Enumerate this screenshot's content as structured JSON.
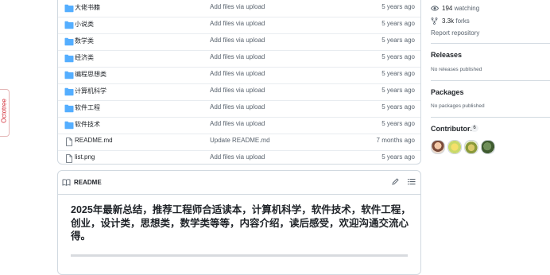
{
  "side_tab": {
    "label": "Octotree"
  },
  "files": [
    {
      "name": "大佬书籍",
      "type": "folder",
      "message": "Add files via upload",
      "age": "5 years ago"
    },
    {
      "name": "小说类",
      "type": "folder",
      "message": "Add files via upload",
      "age": "5 years ago"
    },
    {
      "name": "数学类",
      "type": "folder",
      "message": "Add files via upload",
      "age": "5 years ago"
    },
    {
      "name": "经济类",
      "type": "folder",
      "message": "Add files via upload",
      "age": "5 years ago"
    },
    {
      "name": "编程思想类",
      "type": "folder",
      "message": "Add files via upload",
      "age": "5 years ago"
    },
    {
      "name": "计算机科学",
      "type": "folder",
      "message": "Add files via upload",
      "age": "5 years ago"
    },
    {
      "name": "软件工程",
      "type": "folder",
      "message": "Add files via upload",
      "age": "5 years ago"
    },
    {
      "name": "软件技术",
      "type": "folder",
      "message": "Add files via upload",
      "age": "5 years ago"
    },
    {
      "name": "README.md",
      "type": "file",
      "message": "Update README.md",
      "age": "7 months ago"
    },
    {
      "name": "list.png",
      "type": "file",
      "message": "Add files via upload",
      "age": "5 years ago"
    }
  ],
  "readme": {
    "tab_label": "README",
    "heading": "2025年最新总结，推荐工程师合适读本，计算机科学，软件技术，软件工程，创业，设计类，思想类，数学类等等，内容介绍，读后感受，欢迎沟通交流心得。"
  },
  "sidebar": {
    "watching_count": "194",
    "watching_label": "watching",
    "forks_count": "3.3k",
    "forks_label": "forks",
    "report": "Report repository",
    "releases_title": "Releases",
    "releases_empty": "No releases published",
    "packages_title": "Packages",
    "packages_empty": "No packages published",
    "contributors_title": "Contributors",
    "contributors_count": "6"
  },
  "colors": {
    "folder": "#54aeff",
    "accent_underline": "#fd8c73",
    "link": "#0969da"
  }
}
